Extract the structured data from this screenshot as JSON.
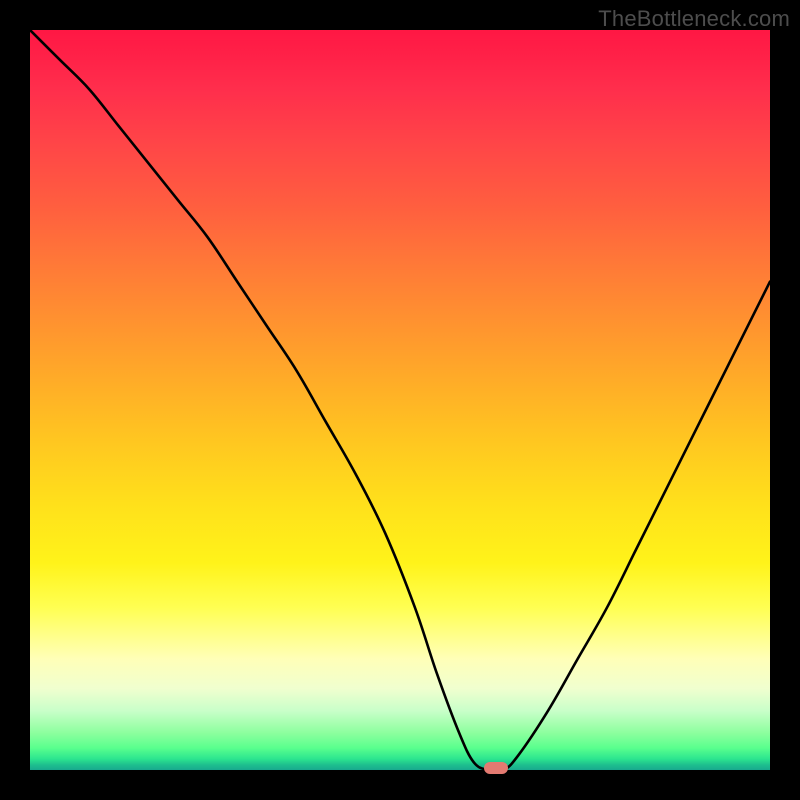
{
  "watermark": "TheBottleneck.com",
  "colors": {
    "frame": "#000000",
    "curve": "#000000",
    "marker": "#e37a71"
  },
  "chart_data": {
    "type": "line",
    "title": "",
    "xlabel": "",
    "ylabel": "",
    "xlim": [
      0,
      100
    ],
    "ylim": [
      0,
      100
    ],
    "grid": false,
    "legend": false,
    "series": [
      {
        "name": "bottleneck-curve",
        "x": [
          0,
          4,
          8,
          12,
          16,
          20,
          24,
          28,
          32,
          36,
          40,
          44,
          48,
          52,
          55,
          58,
          60,
          62,
          64,
          66,
          70,
          74,
          78,
          82,
          86,
          90,
          94,
          98,
          100
        ],
        "values": [
          100,
          96,
          92,
          87,
          82,
          77,
          72,
          66,
          60,
          54,
          47,
          40,
          32,
          22,
          13,
          5,
          1,
          0,
          0,
          2,
          8,
          15,
          22,
          30,
          38,
          46,
          54,
          62,
          66
        ]
      }
    ],
    "marker": {
      "x": 63,
      "y": 0
    },
    "gradient_stops": [
      {
        "pct": 0,
        "color": "#ff1744"
      },
      {
        "pct": 50,
        "color": "#ffc820"
      },
      {
        "pct": 80,
        "color": "#ffff52"
      },
      {
        "pct": 100,
        "color": "#18a98e"
      }
    ]
  }
}
